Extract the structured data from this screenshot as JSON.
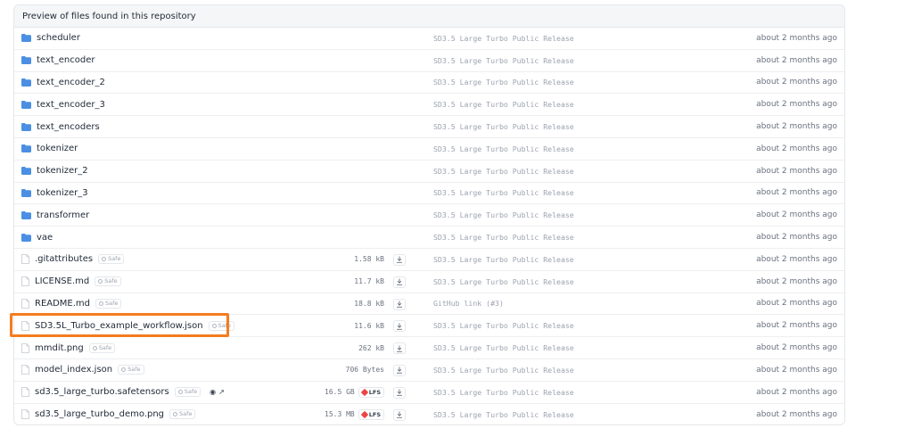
{
  "panel": {
    "header": "Preview of files found in this repository"
  },
  "colors": {
    "folder": "#4a8fe3",
    "highlight": "#f57c20",
    "lfs": "#ef4444"
  },
  "rows": [
    {
      "type": "folder",
      "name": "scheduler",
      "commit": "SD3.5 Large Turbo Public Release",
      "date": "about 2 months ago"
    },
    {
      "type": "folder",
      "name": "text_encoder",
      "commit": "SD3.5 Large Turbo Public Release",
      "date": "about 2 months ago"
    },
    {
      "type": "folder",
      "name": "text_encoder_2",
      "commit": "SD3.5 Large Turbo Public Release",
      "date": "about 2 months ago"
    },
    {
      "type": "folder",
      "name": "text_encoder_3",
      "commit": "SD3.5 Large Turbo Public Release",
      "date": "about 2 months ago"
    },
    {
      "type": "folder",
      "name": "text_encoders",
      "commit": "SD3.5 Large Turbo Public Release",
      "date": "about 2 months ago"
    },
    {
      "type": "folder",
      "name": "tokenizer",
      "commit": "SD3.5 Large Turbo Public Release",
      "date": "about 2 months ago"
    },
    {
      "type": "folder",
      "name": "tokenizer_2",
      "commit": "SD3.5 Large Turbo Public Release",
      "date": "about 2 months ago"
    },
    {
      "type": "folder",
      "name": "tokenizer_3",
      "commit": "SD3.5 Large Turbo Public Release",
      "date": "about 2 months ago"
    },
    {
      "type": "folder",
      "name": "transformer",
      "commit": "SD3.5 Large Turbo Public Release",
      "date": "about 2 months ago"
    },
    {
      "type": "folder",
      "name": "vae",
      "commit": "SD3.5 Large Turbo Public Release",
      "date": "about 2 months ago"
    },
    {
      "type": "file",
      "name": ".gitattributes",
      "safe": "Safe",
      "size": "1.58 kB",
      "commit": "SD3.5 Large Turbo Public Release",
      "date": "about 2 months ago"
    },
    {
      "type": "file",
      "name": "LICENSE.md",
      "safe": "Safe",
      "size": "11.7 kB",
      "commit": "SD3.5 Large Turbo Public Release",
      "date": "about 2 months ago"
    },
    {
      "type": "file",
      "name": "README.md",
      "safe": "Safe",
      "size": "18.8 kB",
      "commit": "GitHub link (#3)",
      "date": "about 2 months ago"
    },
    {
      "type": "file",
      "name": "SD3.5L_Turbo_example_workflow.json",
      "safe": "Safe",
      "size": "11.6 kB",
      "commit": "SD3.5 Large Turbo Public Release",
      "date": "about 2 months ago",
      "highlighted": true
    },
    {
      "type": "file",
      "name": "mmdit.png",
      "safe": "Safe",
      "size": "262 kB",
      "commit": "SD3.5 Large Turbo Public Release",
      "date": "about 2 months ago"
    },
    {
      "type": "file",
      "name": "model_index.json",
      "safe": "Safe",
      "size": "706 Bytes",
      "commit": "SD3.5 Large Turbo Public Release",
      "date": "about 2 months ago"
    },
    {
      "type": "file",
      "name": "sd3.5_large_turbo.safetensors",
      "safe": "Safe",
      "size": "16.5 GB",
      "lfs": "LFS",
      "extra_icons": true,
      "commit": "SD3.5 Large Turbo Public Release",
      "date": "about 2 months ago"
    },
    {
      "type": "file",
      "name": "sd3.5_large_turbo_demo.png",
      "safe": "Safe",
      "size": "15.3 MB",
      "lfs": "LFS",
      "commit": "SD3.5 Large Turbo Public Release",
      "date": "about 2 months ago"
    }
  ]
}
